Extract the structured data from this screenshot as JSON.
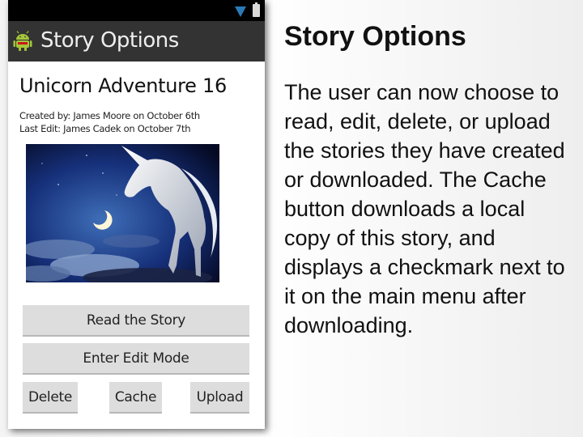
{
  "app": {
    "title": "Story Options"
  },
  "story": {
    "title": "Unicorn Adventure 16",
    "created_line": "Created by: James Moore on October 6th",
    "edit_line": "Last Edit: James Cadek on October 7th",
    "image_subject": "unicorn-moonlit-night"
  },
  "buttons": {
    "read": "Read the Story",
    "edit": "Enter Edit Mode",
    "delete": "Delete",
    "cache": "Cache",
    "upload": "Upload"
  },
  "icons": {
    "status": [
      "wifi-icon",
      "battery-icon"
    ],
    "app": "android-icon"
  },
  "slide": {
    "title": "Story Options",
    "body": "The user can now choose to read, edit, delete, or upload the stories they have created or downloaded. The Cache button downloads a local copy of this story, and displays a checkmark next to it on the main menu after downloading."
  },
  "colors": {
    "status_bar": "#000000",
    "action_bar": "#333333",
    "button_bg": "#dddddd",
    "wifi": "#2a7ab7",
    "android_green": "#a4c639"
  }
}
